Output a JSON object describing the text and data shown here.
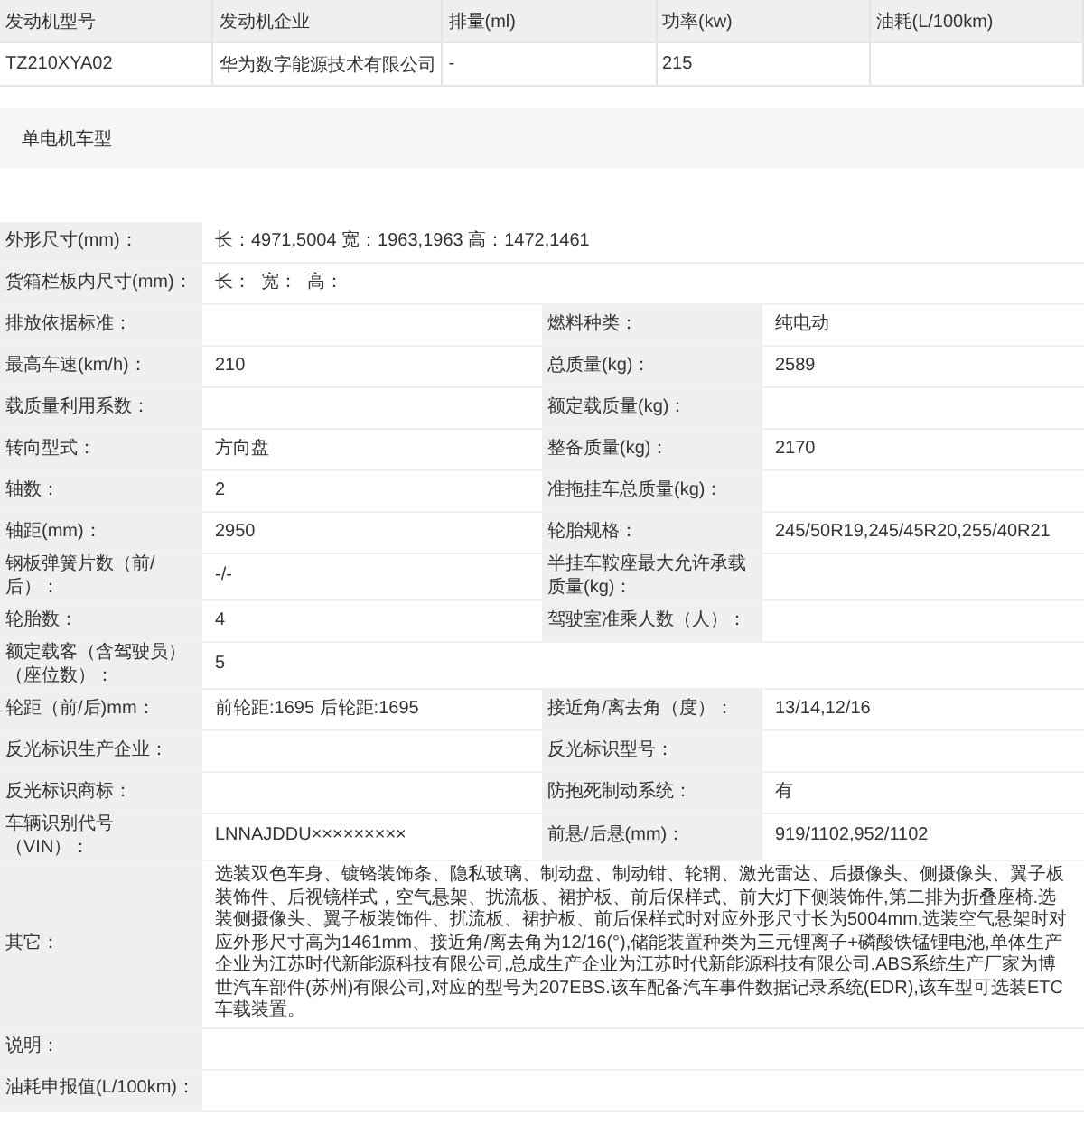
{
  "engine_table": {
    "columns": [
      "发动机型号",
      "发动机企业",
      "排量(ml)",
      "功率(kw)",
      "油耗(L/100km)"
    ],
    "rows": [
      {
        "model": "TZ210XYA02",
        "company": "华为数字能源技术有限公司",
        "displacement": "-",
        "power": "215"
      }
    ]
  },
  "section_title": "单电机车型",
  "spec_rows": [
    {
      "cells": [
        {
          "label": "外形尺寸(mm)：",
          "value": "长：4971,5004 宽：1963,1963 高：1472,1461"
        }
      ]
    },
    {
      "cells": [
        {
          "label": "货箱栏板内尺寸(mm)：",
          "value": "长：  宽：  高："
        }
      ]
    },
    {
      "cells": [
        {
          "label": "排放依据标准："
        },
        {
          "label": "燃料种类：",
          "value": "纯电动"
        }
      ]
    },
    {
      "cells": [
        {
          "label": "最高车速(km/h)：",
          "value": "210"
        },
        {
          "label": "总质量(kg)：",
          "value": "2589"
        }
      ]
    },
    {
      "cells": [
        {
          "label": "载质量利用系数："
        },
        {
          "label": "额定载质量(kg)："
        }
      ]
    },
    {
      "cells": [
        {
          "label": "转向型式：",
          "value": "方向盘"
        },
        {
          "label": "整备质量(kg)：",
          "value": "2170"
        }
      ]
    },
    {
      "cells": [
        {
          "label": "轴数：",
          "value": "2"
        },
        {
          "label": "准拖挂车总质量(kg)："
        }
      ]
    },
    {
      "cells": [
        {
          "label": "轴距(mm)：",
          "value": "2950"
        },
        {
          "label": "轮胎规格：",
          "value": "245/50R19,245/45R20,255/40R21"
        }
      ]
    },
    {
      "cells": [
        {
          "label": "钢板弹簧片数（前/后）：",
          "value": "-/-"
        },
        {
          "label": "半挂车鞍座最大允许承载质量(kg)："
        }
      ]
    },
    {
      "cells": [
        {
          "label": "轮胎数：",
          "value": "4"
        },
        {
          "label": "驾驶室准乘人数（人）："
        }
      ]
    },
    {
      "cells": [
        {
          "label": "额定载客（含驾驶员）（座位数）：",
          "value": "5"
        }
      ]
    },
    {
      "cells": [
        {
          "label": "轮距（前/后)mm：",
          "value": "前轮距:1695 后轮距:1695"
        },
        {
          "label": "接近角/离去角（度）：",
          "value": "13/14,12/16"
        }
      ]
    },
    {
      "cells": [
        {
          "label": "反光标识生产企业："
        },
        {
          "label": "反光标识型号："
        }
      ]
    },
    {
      "cells": [
        {
          "label": "反光标识商标："
        },
        {
          "label": "防抱死制动系统：",
          "value": "有"
        }
      ]
    },
    {
      "cells": [
        {
          "label": "车辆识别代号（VIN）：",
          "value": "LNNAJDDU×××××××××"
        },
        {
          "label": "前悬/后悬(mm)：",
          "value": "919/1102,952/1102"
        }
      ]
    },
    {
      "cells": [
        {
          "label": "其它：",
          "value": "选装双色车身、镀铬装饰条、隐私玻璃、制动盘、制动钳、轮辋、激光雷达、后摄像头、侧摄像头、翼子板装饰件、后视镜样式，空气悬架、扰流板、裙护板、前后保样式、前大灯下侧装饰件,第二排为折叠座椅.选装侧摄像头、翼子板装饰件、扰流板、裙护板、前后保样式时对应外形尺寸长为5004mm,选装空气悬架时对应外形尺寸高为1461mm、接近角/离去角为12/16(°),储能装置种类为三元锂离子+磷酸铁锰锂电池,单体生产企业为江苏时代新能源科技有限公司,总成生产企业为江苏时代新能源科技有限公司.ABS系统生产厂家为博世汽车部件(苏州)有限公司,对应的型号为207EBS.该车配备汽车事件数据记录系统(EDR),该车型可选装ETC车载装置。"
        }
      ]
    },
    {
      "cells": [
        {
          "label": "说明："
        }
      ]
    },
    {
      "cells": [
        {
          "label": "油耗申报值(L/100km)："
        }
      ]
    }
  ]
}
